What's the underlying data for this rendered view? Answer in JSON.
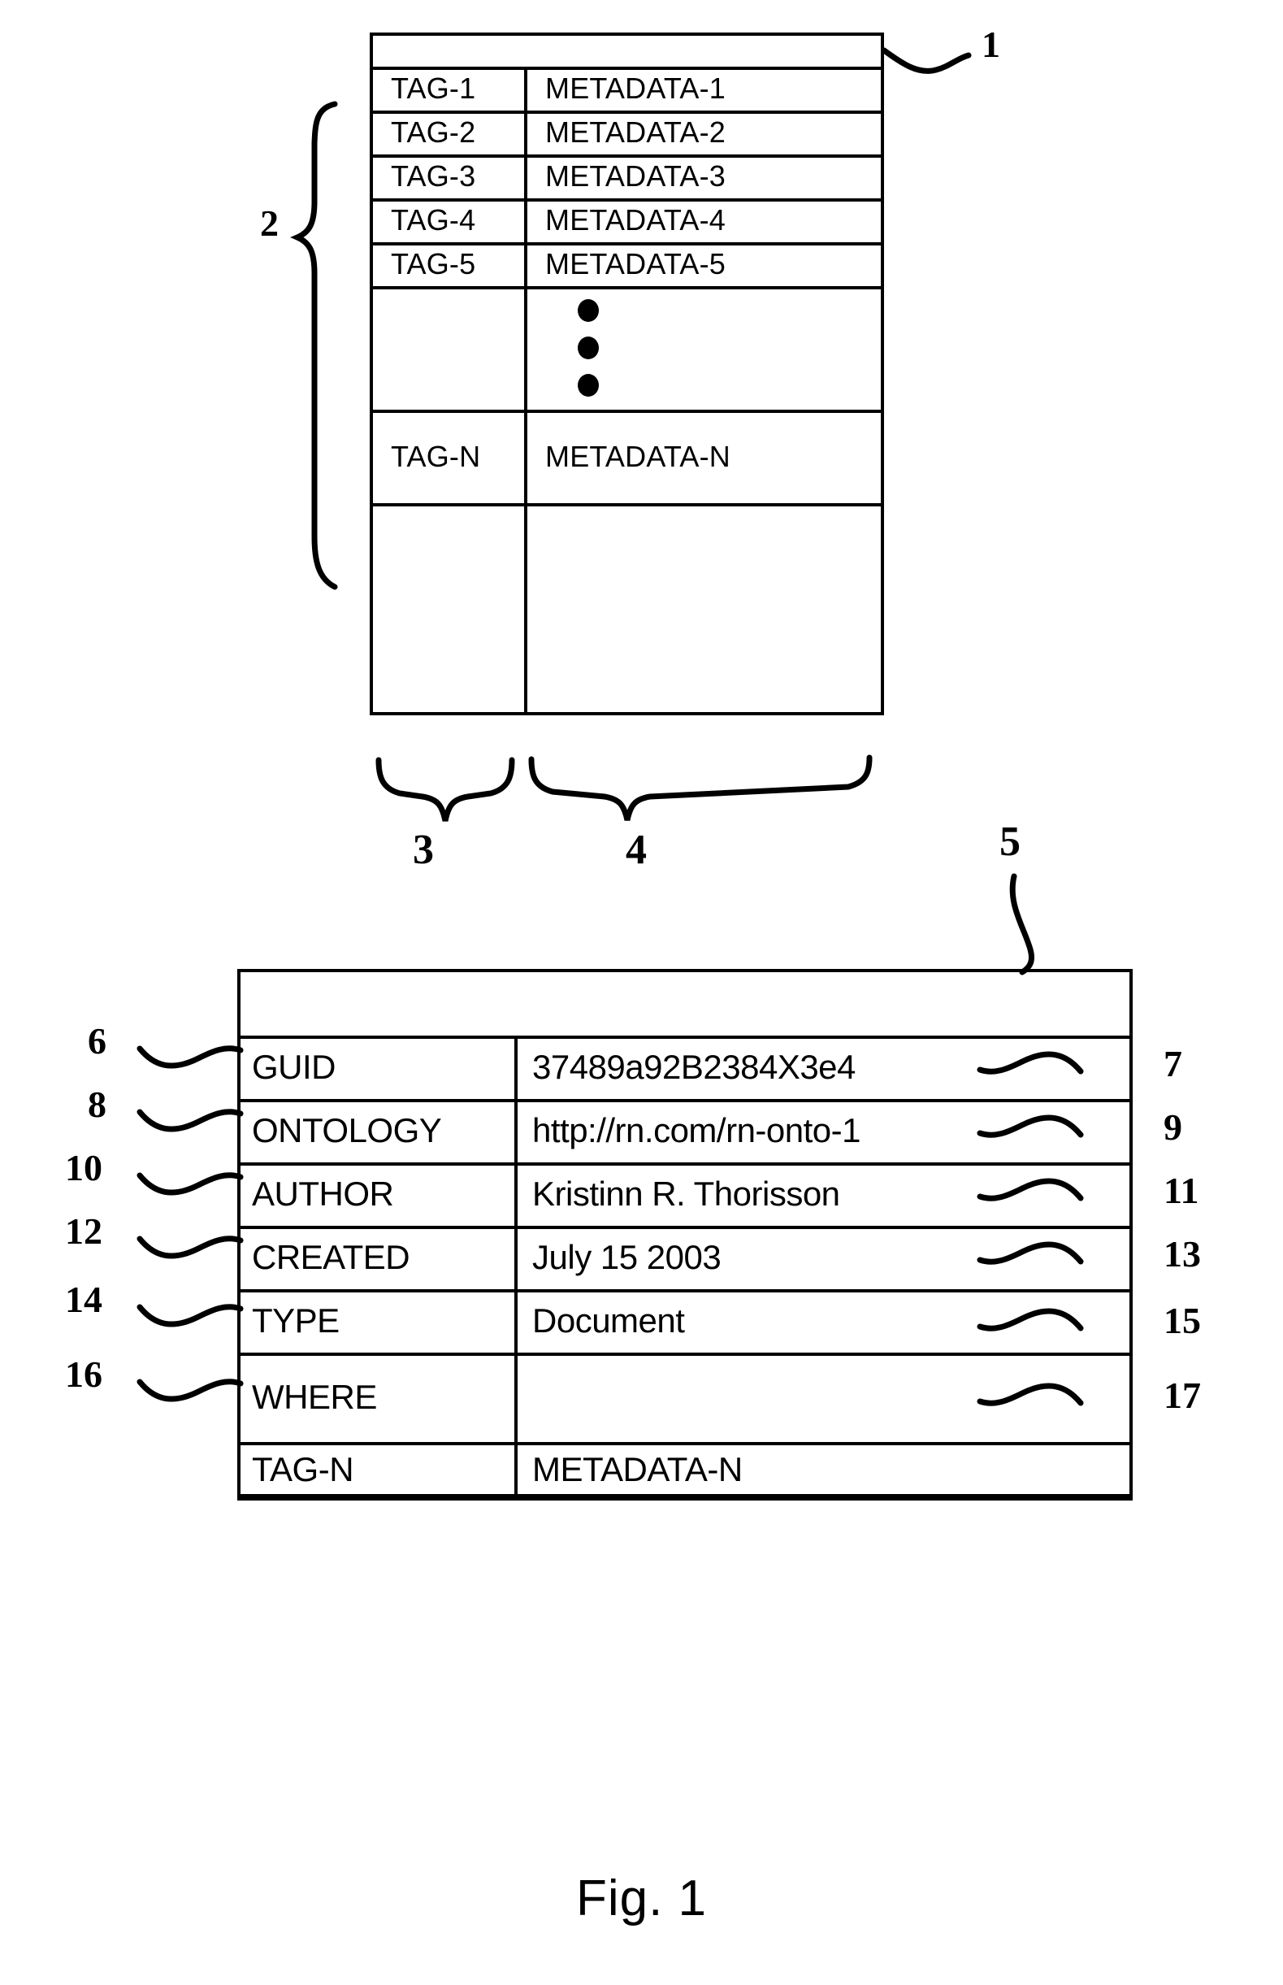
{
  "figure": {
    "caption": "Fig. 1"
  },
  "top_table": {
    "ref_label": "1",
    "group_brace_label": "2",
    "column_brace_labels": {
      "tag_column": "3",
      "metadata_column": "4"
    },
    "rows": [
      {
        "tag": "TAG-1",
        "metadata": "METADATA-1"
      },
      {
        "tag": "TAG-2",
        "metadata": "METADATA-2"
      },
      {
        "tag": "TAG-3",
        "metadata": "METADATA-3"
      },
      {
        "tag": "TAG-4",
        "metadata": "METADATA-4"
      },
      {
        "tag": "TAG-5",
        "metadata": "METADATA-5"
      }
    ],
    "ellipsis_row": {
      "tag": "",
      "metadata": "•••"
    },
    "last_row": {
      "tag": "TAG-N",
      "metadata": "METADATA-N"
    }
  },
  "bottom_table": {
    "ref_label": "5",
    "rows": [
      {
        "key": "GUID",
        "value": "37489a92B2384X3e4",
        "key_ref": "6",
        "value_ref": "7"
      },
      {
        "key": "ONTOLOGY",
        "value": "http://rn.com/rn-onto-1",
        "key_ref": "8",
        "value_ref": "9"
      },
      {
        "key": "AUTHOR",
        "value": "Kristinn R. Thorisson",
        "key_ref": "10",
        "value_ref": "11"
      },
      {
        "key": "CREATED",
        "value": "July 15 2003",
        "key_ref": "12",
        "value_ref": "13"
      },
      {
        "key": "TYPE",
        "value": "Document",
        "key_ref": "14",
        "value_ref": "15"
      },
      {
        "key": "WHERE",
        "value": "",
        "key_ref": "16",
        "value_ref": "17"
      },
      {
        "key": "TAG-N",
        "value": "METADATA-N",
        "key_ref": "",
        "value_ref": ""
      }
    ]
  }
}
